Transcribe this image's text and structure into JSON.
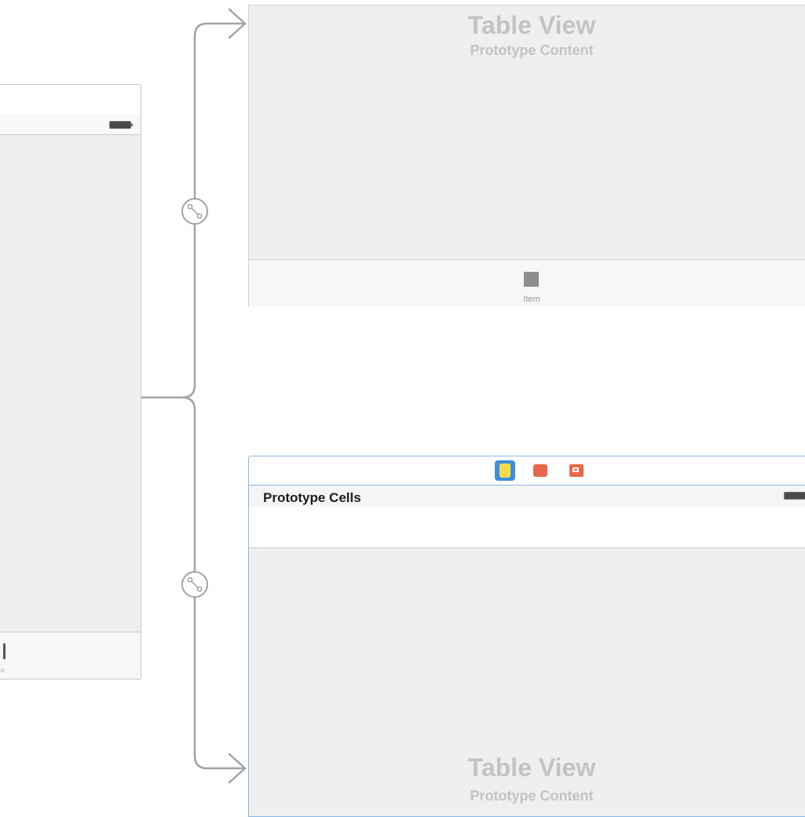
{
  "table_view_scene": {
    "title": "Table View",
    "subtitle": "Prototype Content",
    "tab_item_label": "Item"
  },
  "prototype_scene": {
    "section_header": "Prototype Cells",
    "title": "Table View",
    "subtitle": "Prototype Content",
    "dock_icons": [
      "view-controller-icon",
      "first-responder-icon",
      "exit-icon"
    ]
  },
  "left_scene": {
    "tab_item_label_fragment": "n"
  },
  "segues": [
    "relationship-segue-icon",
    "relationship-segue-icon"
  ],
  "colors": {
    "canvas": "#ffffff",
    "scene_background": "#efefef",
    "selection_border": "#8ab6e1",
    "connector": "#a3a3a3",
    "dock_accent": "#e8674a",
    "view_controller_icon": "#3f8fdc"
  }
}
